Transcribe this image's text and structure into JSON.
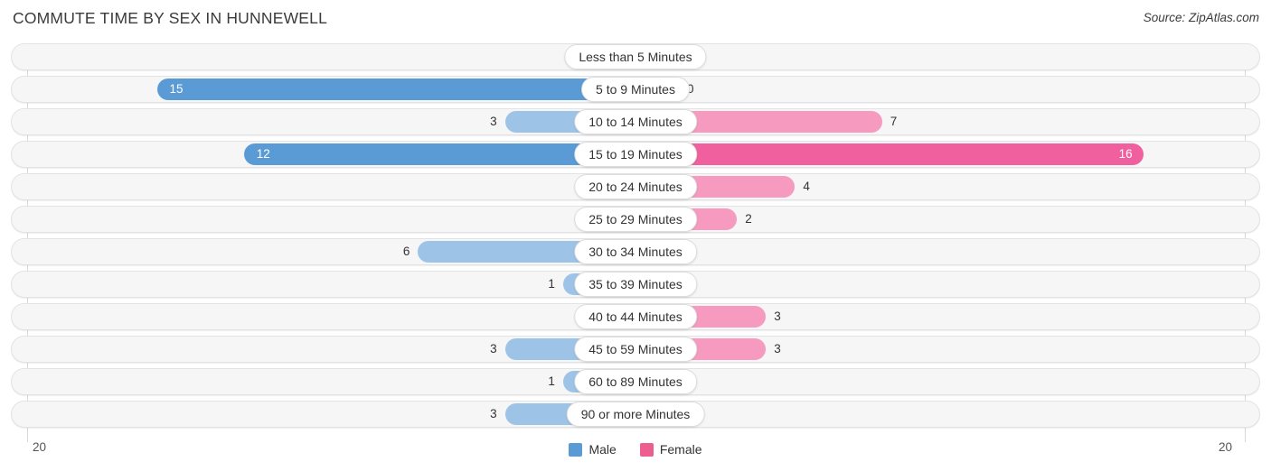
{
  "header": {
    "title": "COMMUTE TIME BY SEX IN HUNNEWELL",
    "source": "Source: ZipAtlas.com"
  },
  "legend": {
    "male_label": "Male",
    "female_label": "Female",
    "male_color": "#5b9bd5",
    "female_color": "#ee5d8f"
  },
  "axis": {
    "left_max": "20",
    "right_max": "20"
  },
  "chart_data": {
    "type": "bar",
    "title": "COMMUTE TIME BY SEX IN HUNNEWELL",
    "xlabel": "",
    "ylabel": "",
    "orientation": "horizontal-diverging",
    "xlim": [
      20,
      20
    ],
    "grid": true,
    "legend_position": "bottom-center",
    "categories": [
      "Less than 5 Minutes",
      "5 to 9 Minutes",
      "10 to 14 Minutes",
      "15 to 19 Minutes",
      "20 to 24 Minutes",
      "25 to 29 Minutes",
      "30 to 34 Minutes",
      "35 to 39 Minutes",
      "40 to 44 Minutes",
      "45 to 59 Minutes",
      "60 to 89 Minutes",
      "90 or more Minutes"
    ],
    "series": [
      {
        "name": "Male",
        "values": [
          0,
          15,
          3,
          12,
          0,
          0,
          6,
          1,
          0,
          3,
          1,
          3
        ]
      },
      {
        "name": "Female",
        "values": [
          0,
          0,
          7,
          16,
          4,
          2,
          0,
          0,
          3,
          3,
          0,
          0
        ]
      }
    ]
  },
  "rows": [
    {
      "label": "Less than 5 Minutes",
      "male": "0",
      "female": "0"
    },
    {
      "label": "5 to 9 Minutes",
      "male": "15",
      "female": "0"
    },
    {
      "label": "10 to 14 Minutes",
      "male": "3",
      "female": "7"
    },
    {
      "label": "15 to 19 Minutes",
      "male": "12",
      "female": "16"
    },
    {
      "label": "20 to 24 Minutes",
      "male": "0",
      "female": "4"
    },
    {
      "label": "25 to 29 Minutes",
      "male": "0",
      "female": "2"
    },
    {
      "label": "30 to 34 Minutes",
      "male": "6",
      "female": "0"
    },
    {
      "label": "35 to 39 Minutes",
      "male": "1",
      "female": "0"
    },
    {
      "label": "40 to 44 Minutes",
      "male": "0",
      "female": "3"
    },
    {
      "label": "45 to 59 Minutes",
      "male": "3",
      "female": "3"
    },
    {
      "label": "60 to 89 Minutes",
      "male": "1",
      "female": "0"
    },
    {
      "label": "90 or more Minutes",
      "male": "3",
      "female": "0"
    }
  ]
}
